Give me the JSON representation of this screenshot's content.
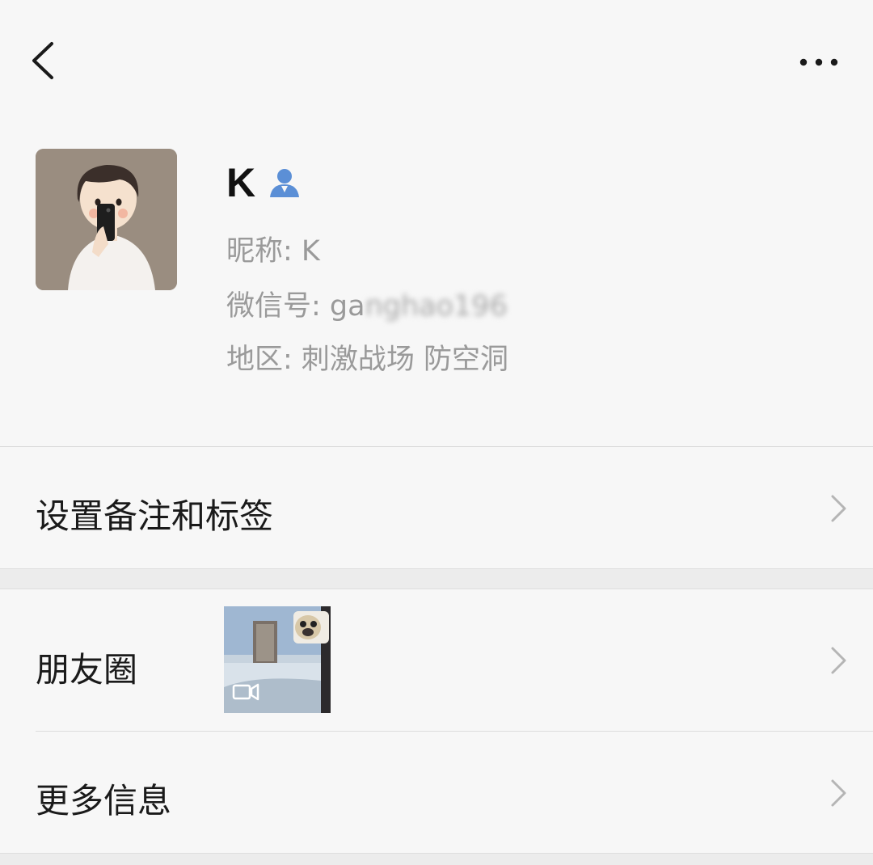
{
  "header": {
    "back_icon": "chevron-left-icon",
    "more_icon": "more-dots-icon"
  },
  "profile": {
    "display_name": "K",
    "contact_icon": "person-icon",
    "contact_icon_color": "#5b8fd6",
    "nickname_label": "昵称: ",
    "nickname_value": "K",
    "wechat_id_label": "微信号: ",
    "wechat_id_value": "ga",
    "wechat_id_blurred": "nghao196",
    "region_label": "地区: ",
    "region_value": "刺激战场 防空洞"
  },
  "rows": {
    "remark_label": "设置备注和标签",
    "moments_label": "朋友圈",
    "more_info_label": "更多信息"
  },
  "colors": {
    "page_bg": "#ededed",
    "card_bg": "#f7f7f7",
    "secondary_text": "#9a9a9a"
  }
}
